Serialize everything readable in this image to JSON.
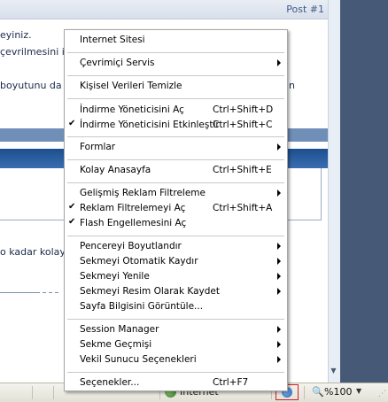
{
  "page": {
    "post_number": "Post #1",
    "lines": [
      "eyiniz.",
      "çevrilmesini is",
      "boyutunu da l",
      "o kadar kolay"
    ],
    "right_fragment": "n"
  },
  "context_menu": {
    "items": [
      {
        "label": "Internet Sitesi",
        "shortcut": "",
        "submenu": false,
        "checked": false
      },
      {
        "label": "Çevrimiçi Servis",
        "shortcut": "",
        "submenu": true,
        "checked": false
      },
      {
        "label": "Kişisel Verileri Temizle",
        "shortcut": "",
        "submenu": false,
        "checked": false
      },
      {
        "label": "İndirme Yöneticisini Aç",
        "shortcut": "Ctrl+Shift+D",
        "submenu": false,
        "checked": false
      },
      {
        "label": "İndirme Yöneticisini Etkinleştir",
        "shortcut": "Ctrl+Shift+C",
        "submenu": false,
        "checked": true
      },
      {
        "label": "Formlar",
        "shortcut": "",
        "submenu": true,
        "checked": false
      },
      {
        "label": "Kolay Anasayfa",
        "shortcut": "Ctrl+Shift+E",
        "submenu": false,
        "checked": false
      },
      {
        "label": "Gelişmiş Reklam Filtreleme",
        "shortcut": "",
        "submenu": true,
        "checked": false
      },
      {
        "label": "Reklam Filtrelemeyi Aç",
        "shortcut": "Ctrl+Shift+A",
        "submenu": false,
        "checked": true
      },
      {
        "label": "Flash Engellemesini Aç",
        "shortcut": "",
        "submenu": false,
        "checked": true
      },
      {
        "label": "Pencereyi Boyutlandır",
        "shortcut": "",
        "submenu": true,
        "checked": false
      },
      {
        "label": "Sekmeyi Otomatik Kaydır",
        "shortcut": "",
        "submenu": true,
        "checked": false
      },
      {
        "label": "Sekmeyi Yenile",
        "shortcut": "",
        "submenu": true,
        "checked": false
      },
      {
        "label": "Sekmeyi Resim Olarak Kaydet",
        "shortcut": "",
        "submenu": true,
        "checked": false
      },
      {
        "label": "Sayfa Bilgisini Görüntüle...",
        "shortcut": "",
        "submenu": false,
        "checked": false
      },
      {
        "label": "Session Manager",
        "shortcut": "",
        "submenu": true,
        "checked": false
      },
      {
        "label": "Sekme Geçmişi",
        "shortcut": "",
        "submenu": true,
        "checked": false
      },
      {
        "label": "Vekil Sunucu Seçenekleri",
        "shortcut": "",
        "submenu": true,
        "checked": false
      },
      {
        "label": "Seçenekler...",
        "shortcut": "Ctrl+F7",
        "submenu": false,
        "checked": false
      }
    ]
  },
  "status_bar": {
    "zone": "Internet",
    "zoom": "%100"
  },
  "colors": {
    "highlight_box": "#d21e1e",
    "right_pane": "#465a78",
    "blue_bar": "#1d4f8f"
  }
}
